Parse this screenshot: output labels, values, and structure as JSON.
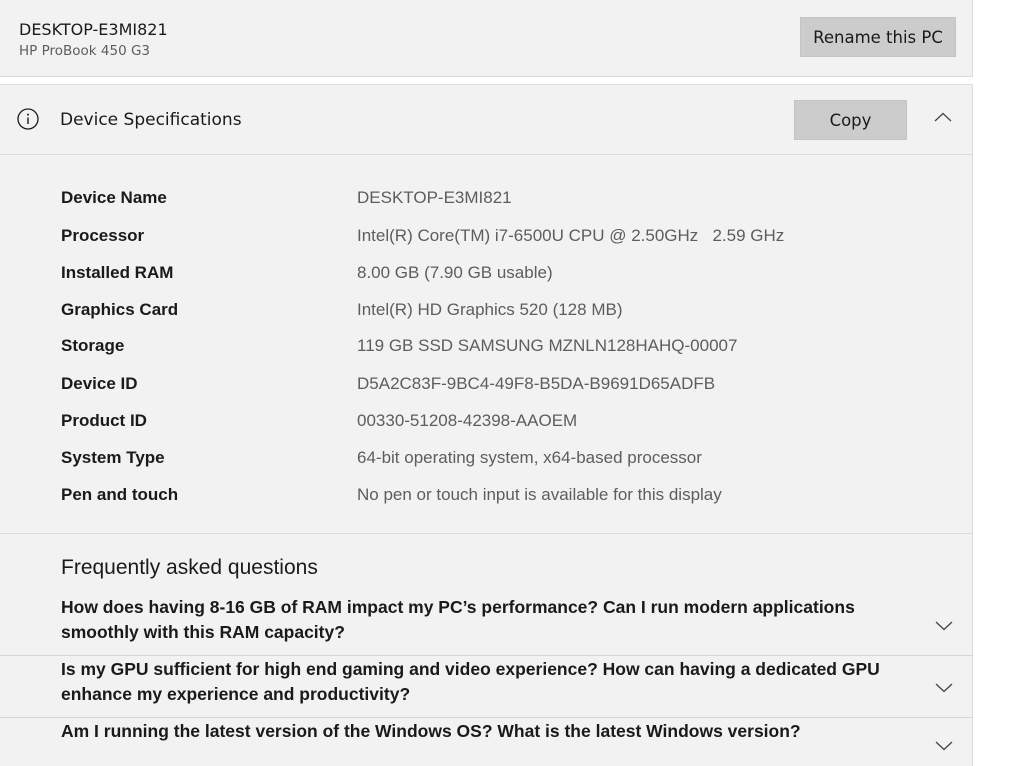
{
  "device": {
    "name": "DESKTOP-E3MI821",
    "model": "HP ProBook 450 G3",
    "rename_label": "Rename this PC"
  },
  "specs": {
    "title": "Device Specifications",
    "copy_label": "Copy",
    "rows": [
      {
        "label": "Device Name",
        "value": "DESKTOP-E3MI821"
      },
      {
        "label": "Processor",
        "value": "Intel(R) Core(TM) i7-6500U CPU @ 2.50GHz   2.59 GHz"
      },
      {
        "label": "Installed RAM",
        "value": "8.00 GB (7.90 GB usable)"
      },
      {
        "label": "Graphics Card",
        "value": "Intel(R) HD Graphics 520 (128 MB)"
      },
      {
        "label": "Storage",
        "value": "119 GB SSD SAMSUNG MZNLN128HAHQ-00007"
      },
      {
        "label": "Device ID",
        "value": "D5A2C83F-9BC4-49F8-B5DA-B9691D65ADFB"
      },
      {
        "label": "Product ID",
        "value": "00330-51208-42398-AAOEM"
      },
      {
        "label": "System Type",
        "value": "64-bit operating system, x64-based processor"
      },
      {
        "label": "Pen and touch",
        "value": "No pen or touch input is available for this display"
      }
    ]
  },
  "faq": {
    "title": "Frequently asked questions",
    "items": [
      {
        "question": "How does having 8-16 GB of RAM impact my PC’s performance? Can I run modern applications smoothly with this RAM capacity?"
      },
      {
        "question": "Is my GPU sufficient for high end gaming and video experience? How can having a dedicated GPU enhance my experience and productivity?"
      },
      {
        "question": "Am I running the latest version of the Windows OS? What is the latest Windows version?"
      }
    ]
  },
  "icons": {
    "info": "info-icon",
    "collapse": "chevron-up-icon",
    "expand": "chevron-down-icon"
  },
  "colors": {
    "panel_bg": "#f2f2f2",
    "button_bg": "#cccccc",
    "secondary_text": "#5d5d5d",
    "primary_text": "#1a1a1a"
  }
}
